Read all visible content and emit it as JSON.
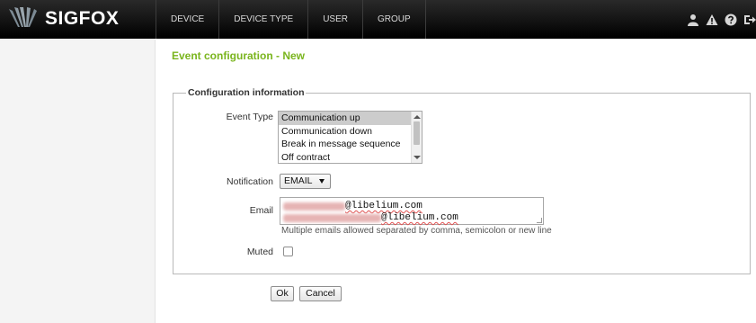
{
  "header": {
    "brand": "SIGFOX",
    "nav": [
      {
        "label": "DEVICE"
      },
      {
        "label": "DEVICE TYPE"
      },
      {
        "label": "USER"
      },
      {
        "label": "GROUP"
      }
    ],
    "icons": [
      "user-icon",
      "warning-icon",
      "help-icon",
      "logout-icon"
    ]
  },
  "page": {
    "title": "Event configuration - New"
  },
  "form": {
    "legend": "Configuration information",
    "event_type": {
      "label": "Event Type",
      "options": [
        "Communication up",
        "Communication down",
        "Break in message sequence",
        "Off contract"
      ],
      "selected": "Communication up"
    },
    "notification": {
      "label": "Notification",
      "value": "EMAIL"
    },
    "email": {
      "label": "Email",
      "lines": [
        {
          "domain": "@libelium.com"
        },
        {
          "domain": "@libelium.com"
        }
      ],
      "help": "Multiple emails allowed separated by comma, semicolon or new line"
    },
    "muted": {
      "label": "Muted",
      "checked": false
    },
    "buttons": {
      "ok": "Ok",
      "cancel": "Cancel"
    }
  },
  "colors": {
    "accent": "#7ab51d",
    "topbar": "#111111"
  }
}
